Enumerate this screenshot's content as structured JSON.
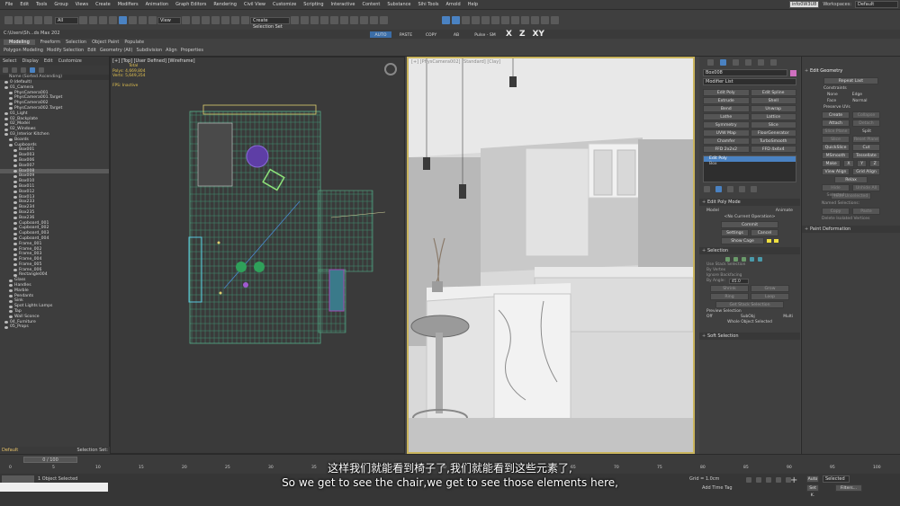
{
  "menu": {
    "items": [
      "File",
      "Edit",
      "Tools",
      "Group",
      "Views",
      "Create",
      "Modifiers",
      "Animation",
      "Graph Editors",
      "Rendering",
      "Civil View",
      "Customize",
      "Scripting",
      "Interactive",
      "Content",
      "Substance",
      "Sihi Tools",
      "Arnold",
      "Help"
    ],
    "user": "info0W3U8",
    "workspaces_label": "Workspaces:",
    "workspace_value": "Default"
  },
  "toolbar": {
    "selection_filter": "All",
    "view_dropdown": "View",
    "selection_set": "Create Selection Set",
    "btn_auto_seam": "AUTO SEAM",
    "btn_paste": "PASTE",
    "btn_copy": "COPY",
    "btn_ab": "AB",
    "btn_pulse": "Pulse - SM",
    "axis_x": "X",
    "axis_z": "Z",
    "axis_xy": "XY",
    "path": "C:\\Users\\Sh...ds Max 202",
    "tab_modeling": "Modeling",
    "tab_freeform": "Freeform",
    "tab_selection": "Selection",
    "tab_object_paint": "Object Paint",
    "tab_populate": "Populate"
  },
  "ribbon": {
    "items": [
      "Polygon Modeling",
      "Modify Selection",
      "Edit",
      "Geometry (All)",
      "Subdivision",
      "Align",
      "Properties"
    ]
  },
  "scene_explorer": {
    "tabs": [
      "Select",
      "Display",
      "Edit",
      "Customize"
    ],
    "header": "Name (Sorted Ascending)",
    "items": [
      {
        "label": "0 (default)",
        "indent": 1,
        "selected": false
      },
      {
        "label": "01_Camera",
        "indent": 1,
        "selected": false
      },
      {
        "label": "PhysCamera001",
        "indent": 2,
        "selected": false
      },
      {
        "label": "PhysCamera001.Target",
        "indent": 2,
        "selected": false
      },
      {
        "label": "PhysCamera002",
        "indent": 2,
        "selected": false
      },
      {
        "label": "PhysCamera002.Target",
        "indent": 2,
        "selected": false
      },
      {
        "label": "01_Light",
        "indent": 1,
        "selected": false
      },
      {
        "label": "02_Backplate",
        "indent": 1,
        "selected": false
      },
      {
        "label": "02_Model",
        "indent": 1,
        "selected": false
      },
      {
        "label": "02_Windows",
        "indent": 1,
        "selected": false
      },
      {
        "label": "03_Interior Kitchen",
        "indent": 1,
        "selected": false
      },
      {
        "label": "Boards",
        "indent": 2,
        "selected": false
      },
      {
        "label": "Cupboards",
        "indent": 2,
        "selected": false
      },
      {
        "label": "Box001",
        "indent": 3,
        "selected": false
      },
      {
        "label": "Box003",
        "indent": 3,
        "selected": false
      },
      {
        "label": "Box006",
        "indent": 3,
        "selected": false
      },
      {
        "label": "Box007",
        "indent": 3,
        "selected": false
      },
      {
        "label": "Box008",
        "indent": 3,
        "selected": true
      },
      {
        "label": "Box009",
        "indent": 3,
        "selected": false
      },
      {
        "label": "Box010",
        "indent": 3,
        "selected": false
      },
      {
        "label": "Box011",
        "indent": 3,
        "selected": false
      },
      {
        "label": "Box012",
        "indent": 3,
        "selected": false
      },
      {
        "label": "Box013",
        "indent": 3,
        "selected": false
      },
      {
        "label": "Box233",
        "indent": 3,
        "selected": false
      },
      {
        "label": "Box234",
        "indent": 3,
        "selected": false
      },
      {
        "label": "Box235",
        "indent": 3,
        "selected": false
      },
      {
        "label": "Box236",
        "indent": 3,
        "selected": false
      },
      {
        "label": "Cupboard_001",
        "indent": 3,
        "selected": false
      },
      {
        "label": "Cupboard_002",
        "indent": 3,
        "selected": false
      },
      {
        "label": "Cupboard_003",
        "indent": 3,
        "selected": false
      },
      {
        "label": "Cupboard_004",
        "indent": 3,
        "selected": false
      },
      {
        "label": "Frame_001",
        "indent": 3,
        "selected": false
      },
      {
        "label": "Frame_002",
        "indent": 3,
        "selected": false
      },
      {
        "label": "Frame_003",
        "indent": 3,
        "selected": false
      },
      {
        "label": "Frame_004",
        "indent": 3,
        "selected": false
      },
      {
        "label": "Frame_005",
        "indent": 3,
        "selected": false
      },
      {
        "label": "Frame_006",
        "indent": 3,
        "selected": false
      },
      {
        "label": "Rectangle004",
        "indent": 3,
        "selected": false
      },
      {
        "label": "Glass",
        "indent": 2,
        "selected": false
      },
      {
        "label": "Handles",
        "indent": 2,
        "selected": false
      },
      {
        "label": "Marble",
        "indent": 2,
        "selected": false
      },
      {
        "label": "Pendants",
        "indent": 2,
        "selected": false
      },
      {
        "label": "Sink",
        "indent": 2,
        "selected": false
      },
      {
        "label": "Spot Lights Lamps",
        "indent": 2,
        "selected": false
      },
      {
        "label": "Tap",
        "indent": 2,
        "selected": false
      },
      {
        "label": "Wall Sconce",
        "indent": 2,
        "selected": false
      },
      {
        "label": "04_Furniture",
        "indent": 1,
        "selected": false
      },
      {
        "label": "05_Props",
        "indent": 1,
        "selected": false
      }
    ],
    "footer_left": "Default",
    "footer_right": "Selection Set:"
  },
  "viewport_top": {
    "label": "[+] [Top] [User Defined] [Wireframe]",
    "stats_total": "Total",
    "stats_polys_label": "Polys:",
    "stats_polys": "4,669,804",
    "stats_verts_label": "Verts:",
    "stats_verts": "5,649,354",
    "fps_label": "FPS:",
    "fps_value": "Inactive"
  },
  "viewport_persp": {
    "label": "[+] [PhysCamera002] [Standard] [Clay]"
  },
  "command_panel": {
    "object_name": "Box008",
    "modifier_list": "Modifier List",
    "mod_buttons": [
      "Edit Poly",
      "Edit Spline",
      "Extrude",
      "Shell",
      "Bend",
      "Unwrap",
      "Lathe",
      "Lattice",
      "Symmetry",
      "Slice",
      "UVW Map",
      "FloorGenerator",
      "Chamfer",
      "TurboSmooth",
      "FFD 2x2x2",
      "FFD 4x4x4"
    ],
    "stack_edit_poly": "Edit Poly",
    "stack_box": "Box",
    "edit_poly_mode": "Edit Poly Mode",
    "model_label": "Model",
    "animate_label": "Animate",
    "no_op": "<No Current Operation>",
    "commit": "Commit",
    "settings": "Settings",
    "cancel": "Cancel",
    "show_cage": "Show Cage",
    "selection": "Selection",
    "use_stack": "Use Stack Selection",
    "by_vertex": "By Vertex",
    "ignore_backfacing": "Ignore Backfacing",
    "by_angle": "By Angle:",
    "by_angle_val": "45.0",
    "shrink": "Shrink",
    "grow": "Grow",
    "ring": "Ring",
    "loop": "Loop",
    "get_stack": "Get Stack Selection",
    "preview_selection": "Preview Selection",
    "off": "Off",
    "subobj": "SubObj",
    "multi": "Multi",
    "whole_object": "Whole Object Selected",
    "soft_selection": "Soft Selection"
  },
  "edit_geometry": {
    "title": "Edit Geometry",
    "repeat_last": "Repeat Last",
    "constraints": "Constraints",
    "none": "None",
    "edge": "Edge",
    "face": "Face",
    "normal": "Normal",
    "preserve_uvs": "Preserve UVs",
    "create": "Create",
    "collapse": "Collapse",
    "attach": "Attach",
    "detach": "Detach",
    "slice_plane": "Slice Plane",
    "split": "Split",
    "slice": "Slice",
    "reset_plane": "Reset Plane",
    "quickslice": "QuickSlice",
    "cut": "Cut",
    "msmooth": "MSmooth",
    "tessellate": "Tessellate",
    "make_planar": "Make Planar",
    "x": "X",
    "y": "Y",
    "z": "Z",
    "view_align": "View Align",
    "grid_align": "Grid Align",
    "relax": "Relax",
    "hide_selected": "Hide Selected",
    "unhide_all": "Unhide All",
    "hide_unselected": "Hide Unselected",
    "named_selections": "Named Selections:",
    "copy": "Copy",
    "paste": "Paste",
    "delete_isolated": "Delete Isolated Vertices",
    "paint_deformation": "Paint Deformation"
  },
  "timeline": {
    "frame_counter": "0 / 100",
    "ticks": [
      "0",
      "5",
      "10",
      "15",
      "20",
      "25",
      "30",
      "35",
      "40",
      "45",
      "50",
      "55",
      "60",
      "65",
      "70",
      "75",
      "80",
      "85",
      "90",
      "95",
      "100"
    ]
  },
  "status": {
    "objects_selected": "1 Object Selected",
    "grid": "Grid = 1.0cm",
    "add_time_tag": "Add Time Tag",
    "auto": "Auto",
    "selected": "Selected",
    "set_k": "Set K.",
    "filters": "Filters..."
  },
  "subtitles": {
    "zh": "这样我们就能看到椅子了,我们就能看到这些元素了,",
    "en": "So we get to see the chair,we get to see those elements here,"
  }
}
